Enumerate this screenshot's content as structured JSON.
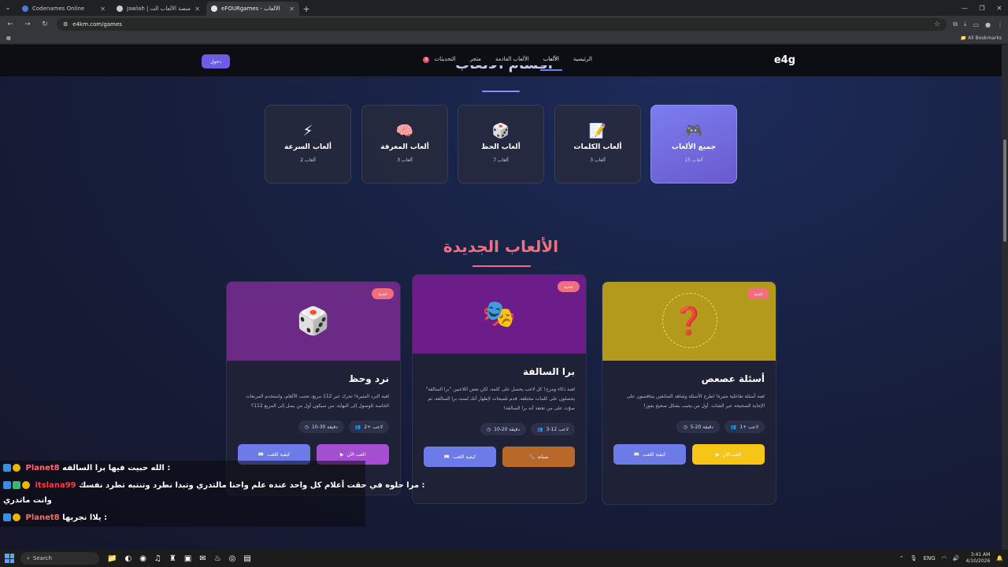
{
  "browser": {
    "tabs": [
      {
        "title": "Codenames Online",
        "color": "#4f7bd8"
      },
      {
        "title": "Jawlah | جولة - منصة الألعاب الت",
        "color": "#c9c9c9"
      },
      {
        "title": "eFOURgames - الألعاب",
        "color": "#e8e8e8",
        "active": true
      }
    ],
    "url": "e4km.com/games",
    "bookmarks_label": "All Bookmarks"
  },
  "site": {
    "logo": "e4g",
    "nav": [
      {
        "label": "الرئيسية"
      },
      {
        "label": "الألعاب",
        "active": true
      },
      {
        "label": "الألعاب القادمة"
      },
      {
        "label": "متجر"
      },
      {
        "label": "التحديثات",
        "badge": "8"
      }
    ],
    "login_label": "دخول",
    "categories_title": "أقسام الألعاب"
  },
  "categories": [
    {
      "name": "جميع الألعاب",
      "count": "15 ألعاب",
      "icon": "gamepad-icon",
      "glyph": "🎮",
      "active": true
    },
    {
      "name": "ألعاب الكلمات",
      "count": "3 ألعاب",
      "icon": "memo-icon",
      "glyph": "📝"
    },
    {
      "name": "ألعاب الحظ",
      "count": "7 ألعاب",
      "icon": "dice-icon",
      "glyph": "🎲"
    },
    {
      "name": "ألعاب المعرفة",
      "count": "3 ألعاب",
      "icon": "brain-icon",
      "glyph": "🧠"
    },
    {
      "name": "ألعاب السرعة",
      "count": "2 ألعاب",
      "icon": "lightning-icon",
      "glyph": "⚡"
    }
  ],
  "new_games_title": "الألعاب الجديدة",
  "games": [
    {
      "title": "أسئلة عصعص",
      "badge": "جديد",
      "banner_color": "#b39a1c",
      "icon": "question-icon",
      "glyph": "❓",
      "description": "لعبة أسئلة تفاعلية مثيرة! اطرح الأسئلة وشاهد المتابعين يتنافسون على الإجابة الصحيحة عبر الشات. أول من يجيب بشكل صحيح يفوز!",
      "players": "1+ لاعب",
      "duration": "5-20 دقيقة",
      "primary_label": "العب الآن",
      "primary_color": "#f5c518",
      "secondary_label": "كيفية اللعب",
      "secondary_color": "#6c7be8"
    },
    {
      "title": "برا السالفة",
      "badge": "جديد",
      "banner_color": "#6d1d8a",
      "icon": "theater-masks-icon",
      "glyph": "🎭",
      "description": "لعبة ذكاء ومرح! كل لاعب يحصل على كلمة، لكن بعض اللاعبين \"برا السالفة\" يحصلون على كلمات مختلفة. قدم تلميحات لإظهار أنك لست برا السالفة، ثم صوّت على من تعتقد أنه برا السالفة!",
      "players": "3-12 لاعب",
      "duration": "10-20 دقيقة",
      "primary_label": "صيانة",
      "primary_color": "#b8692a",
      "secondary_label": "كيفية اللعب",
      "secondary_color": "#6c7be8"
    },
    {
      "title": "نرد وحظ",
      "badge": "جديد",
      "banner_color": "#6a2a86",
      "icon": "dice-icon",
      "glyph": "🎲",
      "description": "لعبة النرد المثيرة! تحرك عبر 112 مربع، تجنب الألغام، واستخدم المربعات الخاصة للوصول إلى النهاية. من سيكون أول من يصل إلى المربع 112؟",
      "players": "2+ لاعب",
      "duration": "10-30 دقيقة",
      "primary_label": "العب الآن",
      "primary_color": "#a44fd0",
      "secondary_label": "كيفية اللعب",
      "secondary_color": "#6c7be8"
    }
  ],
  "chat": [
    {
      "user": "Planet8",
      "message": "الله حبيت فيها برا السالفه :"
    },
    {
      "user": "itslana99",
      "message": "مرا حلوه في حقت أعلام كل واحد عنده علم واحنا مالتدري وتبدا نطرد وتنتبه تطرد نفسك :",
      "continuation": "وانت ماتدري"
    },
    {
      "user": "Planet8",
      "message": "يلاا نجربها :"
    }
  ],
  "taskbar": {
    "search_label": "Search",
    "language": "ENG",
    "time": "3:41 AM",
    "date": "4/10/2026"
  }
}
